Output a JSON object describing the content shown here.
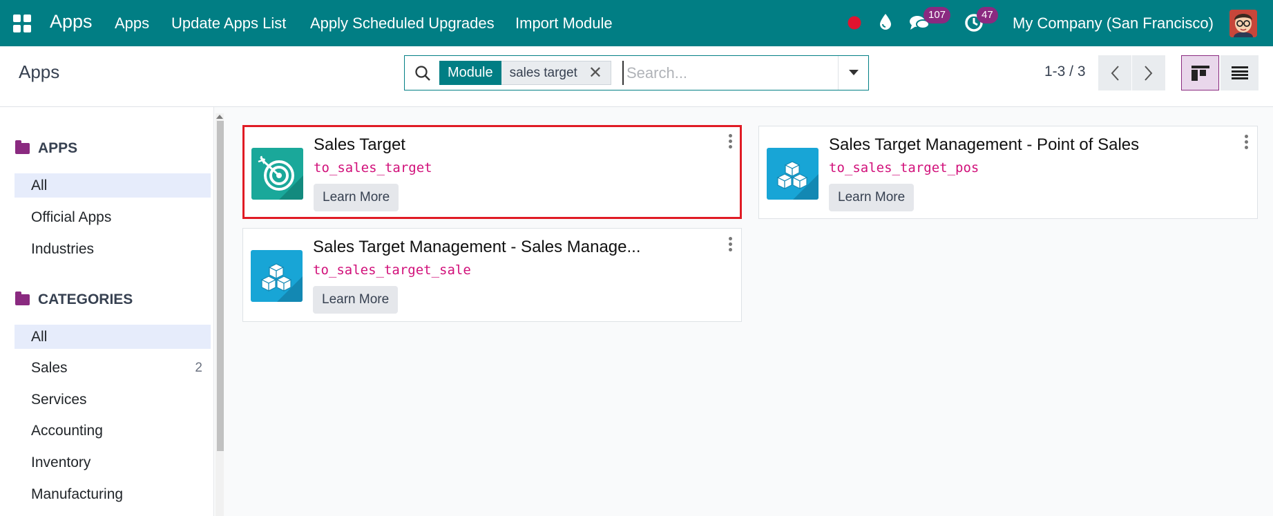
{
  "navbar": {
    "brand": "Apps",
    "menu": [
      "Apps",
      "Update Apps List",
      "Apply Scheduled Upgrades",
      "Import Module"
    ],
    "messages_count": "107",
    "activities_count": "47",
    "company": "My Company (San Francisco)",
    "accent": "#017e84"
  },
  "control": {
    "breadcrumb": "Apps",
    "facet_label": "Module",
    "facet_value": "sales target",
    "search_placeholder": "Search...",
    "pager": "1-3 / 3"
  },
  "sidebar": {
    "apps_heading": "APPS",
    "apps_items": [
      "All",
      "Official Apps",
      "Industries"
    ],
    "categories_heading": "CATEGORIES",
    "categories_items": [
      {
        "label": "All",
        "count": ""
      },
      {
        "label": "Sales",
        "count": "2"
      },
      {
        "label": "Services",
        "count": ""
      },
      {
        "label": "Accounting",
        "count": ""
      },
      {
        "label": "Inventory",
        "count": ""
      },
      {
        "label": "Manufacturing",
        "count": ""
      }
    ]
  },
  "cards": [
    {
      "title": "Sales Target",
      "technical_name": "to_sales_target",
      "button": "Learn More",
      "icon": "target-icon"
    },
    {
      "title": "Sales Target Management - Point of Sales",
      "technical_name": "to_sales_target_pos",
      "button": "Learn More",
      "icon": "cubes-icon"
    },
    {
      "title": "Sales Target Management - Sales Manage...",
      "technical_name": "to_sales_target_sale",
      "button": "Learn More",
      "icon": "cubes-icon"
    }
  ]
}
